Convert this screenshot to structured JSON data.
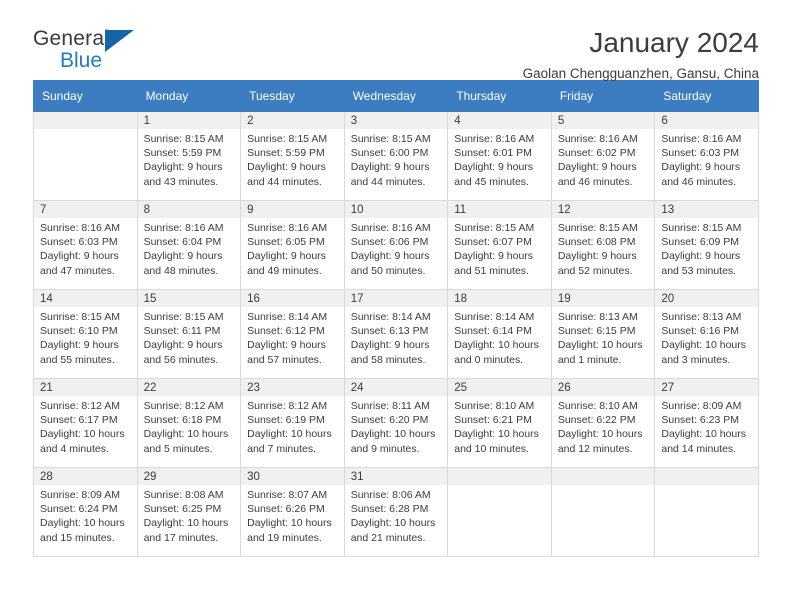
{
  "brand": {
    "name_top": "General",
    "name_bottom": "Blue",
    "triangle_color": "#1565a8",
    "blue_text_color": "#1f7dc4"
  },
  "header": {
    "title": "January 2024",
    "subtitle": "Gaolan Chengguanzhen, Gansu, China"
  },
  "theme": {
    "header_row_bg": "#3b7dc0",
    "header_row_text": "#ffffff",
    "daynum_band_bg": "#f0f0f0",
    "grid_border": "#d9d9d9",
    "body_text": "#3c3c3c"
  },
  "calendar": {
    "weekday_headers": [
      "Sunday",
      "Monday",
      "Tuesday",
      "Wednesday",
      "Thursday",
      "Friday",
      "Saturday"
    ],
    "labels": {
      "sunrise": "Sunrise:",
      "sunset": "Sunset:",
      "daylight": "Daylight:"
    },
    "weeks": [
      [
        {
          "day": ""
        },
        {
          "day": "1",
          "sunrise": "Sunrise: 8:15 AM",
          "sunset": "Sunset: 5:59 PM",
          "daylight_l1": "Daylight: 9 hours",
          "daylight_l2": "and 43 minutes."
        },
        {
          "day": "2",
          "sunrise": "Sunrise: 8:15 AM",
          "sunset": "Sunset: 5:59 PM",
          "daylight_l1": "Daylight: 9 hours",
          "daylight_l2": "and 44 minutes."
        },
        {
          "day": "3",
          "sunrise": "Sunrise: 8:15 AM",
          "sunset": "Sunset: 6:00 PM",
          "daylight_l1": "Daylight: 9 hours",
          "daylight_l2": "and 44 minutes."
        },
        {
          "day": "4",
          "sunrise": "Sunrise: 8:16 AM",
          "sunset": "Sunset: 6:01 PM",
          "daylight_l1": "Daylight: 9 hours",
          "daylight_l2": "and 45 minutes."
        },
        {
          "day": "5",
          "sunrise": "Sunrise: 8:16 AM",
          "sunset": "Sunset: 6:02 PM",
          "daylight_l1": "Daylight: 9 hours",
          "daylight_l2": "and 46 minutes."
        },
        {
          "day": "6",
          "sunrise": "Sunrise: 8:16 AM",
          "sunset": "Sunset: 6:03 PM",
          "daylight_l1": "Daylight: 9 hours",
          "daylight_l2": "and 46 minutes."
        }
      ],
      [
        {
          "day": "7",
          "sunrise": "Sunrise: 8:16 AM",
          "sunset": "Sunset: 6:03 PM",
          "daylight_l1": "Daylight: 9 hours",
          "daylight_l2": "and 47 minutes."
        },
        {
          "day": "8",
          "sunrise": "Sunrise: 8:16 AM",
          "sunset": "Sunset: 6:04 PM",
          "daylight_l1": "Daylight: 9 hours",
          "daylight_l2": "and 48 minutes."
        },
        {
          "day": "9",
          "sunrise": "Sunrise: 8:16 AM",
          "sunset": "Sunset: 6:05 PM",
          "daylight_l1": "Daylight: 9 hours",
          "daylight_l2": "and 49 minutes."
        },
        {
          "day": "10",
          "sunrise": "Sunrise: 8:16 AM",
          "sunset": "Sunset: 6:06 PM",
          "daylight_l1": "Daylight: 9 hours",
          "daylight_l2": "and 50 minutes."
        },
        {
          "day": "11",
          "sunrise": "Sunrise: 8:15 AM",
          "sunset": "Sunset: 6:07 PM",
          "daylight_l1": "Daylight: 9 hours",
          "daylight_l2": "and 51 minutes."
        },
        {
          "day": "12",
          "sunrise": "Sunrise: 8:15 AM",
          "sunset": "Sunset: 6:08 PM",
          "daylight_l1": "Daylight: 9 hours",
          "daylight_l2": "and 52 minutes."
        },
        {
          "day": "13",
          "sunrise": "Sunrise: 8:15 AM",
          "sunset": "Sunset: 6:09 PM",
          "daylight_l1": "Daylight: 9 hours",
          "daylight_l2": "and 53 minutes."
        }
      ],
      [
        {
          "day": "14",
          "sunrise": "Sunrise: 8:15 AM",
          "sunset": "Sunset: 6:10 PM",
          "daylight_l1": "Daylight: 9 hours",
          "daylight_l2": "and 55 minutes."
        },
        {
          "day": "15",
          "sunrise": "Sunrise: 8:15 AM",
          "sunset": "Sunset: 6:11 PM",
          "daylight_l1": "Daylight: 9 hours",
          "daylight_l2": "and 56 minutes."
        },
        {
          "day": "16",
          "sunrise": "Sunrise: 8:14 AM",
          "sunset": "Sunset: 6:12 PM",
          "daylight_l1": "Daylight: 9 hours",
          "daylight_l2": "and 57 minutes."
        },
        {
          "day": "17",
          "sunrise": "Sunrise: 8:14 AM",
          "sunset": "Sunset: 6:13 PM",
          "daylight_l1": "Daylight: 9 hours",
          "daylight_l2": "and 58 minutes."
        },
        {
          "day": "18",
          "sunrise": "Sunrise: 8:14 AM",
          "sunset": "Sunset: 6:14 PM",
          "daylight_l1": "Daylight: 10 hours",
          "daylight_l2": "and 0 minutes."
        },
        {
          "day": "19",
          "sunrise": "Sunrise: 8:13 AM",
          "sunset": "Sunset: 6:15 PM",
          "daylight_l1": "Daylight: 10 hours",
          "daylight_l2": "and 1 minute."
        },
        {
          "day": "20",
          "sunrise": "Sunrise: 8:13 AM",
          "sunset": "Sunset: 6:16 PM",
          "daylight_l1": "Daylight: 10 hours",
          "daylight_l2": "and 3 minutes."
        }
      ],
      [
        {
          "day": "21",
          "sunrise": "Sunrise: 8:12 AM",
          "sunset": "Sunset: 6:17 PM",
          "daylight_l1": "Daylight: 10 hours",
          "daylight_l2": "and 4 minutes."
        },
        {
          "day": "22",
          "sunrise": "Sunrise: 8:12 AM",
          "sunset": "Sunset: 6:18 PM",
          "daylight_l1": "Daylight: 10 hours",
          "daylight_l2": "and 5 minutes."
        },
        {
          "day": "23",
          "sunrise": "Sunrise: 8:12 AM",
          "sunset": "Sunset: 6:19 PM",
          "daylight_l1": "Daylight: 10 hours",
          "daylight_l2": "and 7 minutes."
        },
        {
          "day": "24",
          "sunrise": "Sunrise: 8:11 AM",
          "sunset": "Sunset: 6:20 PM",
          "daylight_l1": "Daylight: 10 hours",
          "daylight_l2": "and 9 minutes."
        },
        {
          "day": "25",
          "sunrise": "Sunrise: 8:10 AM",
          "sunset": "Sunset: 6:21 PM",
          "daylight_l1": "Daylight: 10 hours",
          "daylight_l2": "and 10 minutes."
        },
        {
          "day": "26",
          "sunrise": "Sunrise: 8:10 AM",
          "sunset": "Sunset: 6:22 PM",
          "daylight_l1": "Daylight: 10 hours",
          "daylight_l2": "and 12 minutes."
        },
        {
          "day": "27",
          "sunrise": "Sunrise: 8:09 AM",
          "sunset": "Sunset: 6:23 PM",
          "daylight_l1": "Daylight: 10 hours",
          "daylight_l2": "and 14 minutes."
        }
      ],
      [
        {
          "day": "28",
          "sunrise": "Sunrise: 8:09 AM",
          "sunset": "Sunset: 6:24 PM",
          "daylight_l1": "Daylight: 10 hours",
          "daylight_l2": "and 15 minutes."
        },
        {
          "day": "29",
          "sunrise": "Sunrise: 8:08 AM",
          "sunset": "Sunset: 6:25 PM",
          "daylight_l1": "Daylight: 10 hours",
          "daylight_l2": "and 17 minutes."
        },
        {
          "day": "30",
          "sunrise": "Sunrise: 8:07 AM",
          "sunset": "Sunset: 6:26 PM",
          "daylight_l1": "Daylight: 10 hours",
          "daylight_l2": "and 19 minutes."
        },
        {
          "day": "31",
          "sunrise": "Sunrise: 8:06 AM",
          "sunset": "Sunset: 6:28 PM",
          "daylight_l1": "Daylight: 10 hours",
          "daylight_l2": "and 21 minutes."
        },
        {
          "day": ""
        },
        {
          "day": ""
        },
        {
          "day": ""
        }
      ]
    ]
  }
}
